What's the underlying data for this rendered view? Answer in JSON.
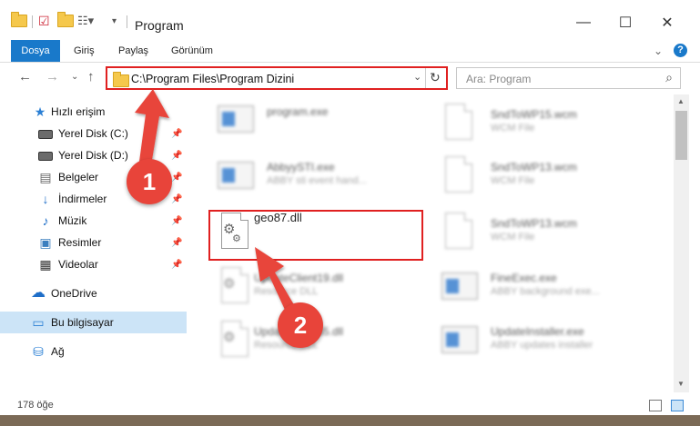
{
  "window": {
    "title": "Program",
    "min_glyph": "—",
    "max_glyph": "☐",
    "close_glyph": "✕"
  },
  "ribbon": {
    "tabs": [
      "Dosya",
      "Giriş",
      "Paylaş",
      "Görünüm"
    ],
    "active_tab": "Dosya",
    "expand_glyph": "⌄",
    "help_glyph": "?"
  },
  "nav": {
    "back": "←",
    "forward": "→",
    "recent": "⌄",
    "up": "↑",
    "address": "C:\\Program Files\\Program Dizini",
    "address_dropdown": "⌄",
    "refresh": "↻",
    "search_placeholder": "Ara: Program",
    "search_glyph": "⌕"
  },
  "sidebar": {
    "quick_access": "Hızlı erişim",
    "items": [
      {
        "label": "Yerel Disk (C:)",
        "icon": "drive-icon",
        "pinned": true
      },
      {
        "label": "Yerel Disk (D:)",
        "icon": "drive-icon",
        "pinned": true
      },
      {
        "label": "Belgeler",
        "icon": "documents-icon",
        "pinned": true
      },
      {
        "label": "İndirmeler",
        "icon": "download-icon",
        "pinned": true
      },
      {
        "label": "Müzik",
        "icon": "music-icon",
        "pinned": true
      },
      {
        "label": "Resimler",
        "icon": "pictures-icon",
        "pinned": true
      },
      {
        "label": "Videolar",
        "icon": "videos-icon",
        "pinned": true
      }
    ],
    "onedrive": "OneDrive",
    "this_pc": "Bu bilgisayar",
    "network": "Ağ"
  },
  "files": [
    {
      "name": "program.exe",
      "desc": "",
      "icon": "installer-icon"
    },
    {
      "name": "SndToWP15.wcm",
      "desc": "WCM File",
      "icon": "document-icon"
    },
    {
      "name": "AbbyySTI.exe",
      "desc": "ABBY sti event hand...",
      "icon": "application-icon"
    },
    {
      "name": "SndToWP13.wcm",
      "desc": "WCM File",
      "icon": "document-icon"
    },
    {
      "name": "geo87.dll",
      "desc": "",
      "icon": "dll-gears-icon"
    },
    {
      "name": "SndToWP13.wcm",
      "desc": "WCM File",
      "icon": "document-icon"
    },
    {
      "name": "UpdateClient19.dll",
      "desc": "Resource DLL",
      "icon": "dll-gears-icon"
    },
    {
      "name": "FineExec.exe",
      "desc": "ABBY background exe...",
      "icon": "application-icon"
    },
    {
      "name": "UpdateClient65.dll",
      "desc": "Resource DLL",
      "icon": "dll-gears-icon"
    },
    {
      "name": "UpdateInstaller.exe",
      "desc": "ABBY updates installer",
      "icon": "application-icon"
    }
  ],
  "status": {
    "count": "178 öğe"
  },
  "markers": {
    "one": "1",
    "two": "2"
  },
  "colors": {
    "accent": "#1979ca",
    "highlight_red": "#e02020",
    "marker_red": "#e8443a",
    "selection": "#cce4f7"
  }
}
